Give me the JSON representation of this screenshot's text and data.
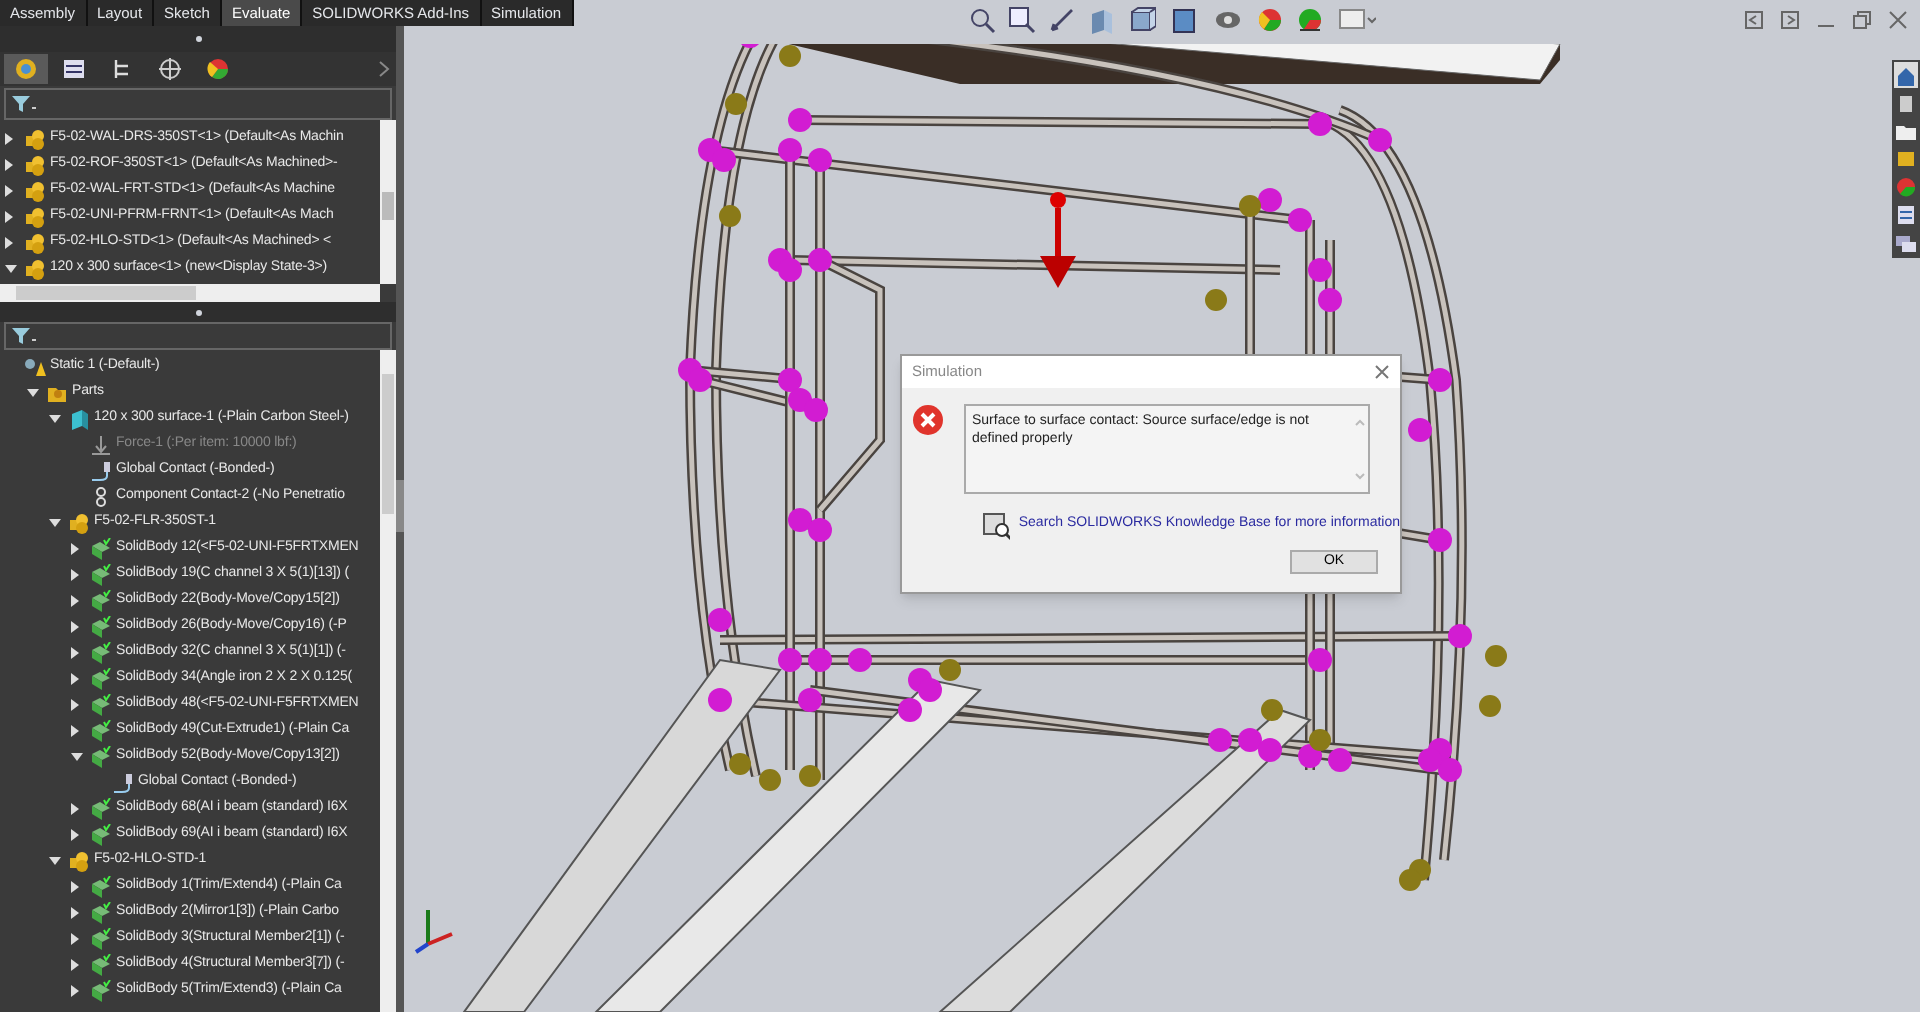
{
  "command_tabs": [
    {
      "label": "Assembly",
      "selected": false
    },
    {
      "label": "Layout",
      "selected": false
    },
    {
      "label": "Sketch",
      "selected": false
    },
    {
      "label": "Evaluate",
      "selected": true
    },
    {
      "label": "SOLIDWORKS Add-Ins",
      "selected": false
    },
    {
      "label": "Simulation",
      "selected": false
    }
  ],
  "feature_tree": {
    "items": [
      {
        "kind": "assembly",
        "label": "F5-02-WAL-DRS-350ST<1> (Default<As Machin",
        "expanded": false
      },
      {
        "kind": "assembly",
        "label": "F5-02-ROF-350ST<1> (Default<As Machined>-",
        "expanded": false
      },
      {
        "kind": "assembly",
        "label": "F5-02-WAL-FRT-STD<1> (Default<As Machine",
        "expanded": false
      },
      {
        "kind": "assembly",
        "label": "F5-02-UNI-PFRM-FRNT<1> (Default<As Mach",
        "expanded": false
      },
      {
        "kind": "assembly",
        "label": "F5-02-HLO-STD<1> (Default<As Machined> <",
        "expanded": false
      },
      {
        "kind": "assembly",
        "label": "120 x 300 surface<1> (new<Display State-3>)",
        "expanded": true
      }
    ]
  },
  "study_tree": {
    "items": [
      {
        "kind": "study",
        "label": "Static 1 (-Default-)",
        "children": [
          {
            "kind": "folder",
            "label": "Parts",
            "expanded": true,
            "children": [
              {
                "kind": "surface",
                "label": "120 x 300 surface-1 (-Plain Carbon Steel-)",
                "expanded": true,
                "children": [
                  {
                    "kind": "load",
                    "label": "Force-1 (:Per item: 10000 lbf:)",
                    "disabled": true
                  },
                  {
                    "kind": "contact",
                    "label": "Global Contact (-Bonded-)",
                    "disabled": false
                  },
                  {
                    "kind": "component-contact",
                    "label": "Component Contact-2 (-No Penetratio",
                    "disabled": false
                  }
                ]
              },
              {
                "kind": "assembly",
                "label": "F5-02-FLR-350ST-1",
                "expanded": true,
                "children": [
                  {
                    "kind": "body",
                    "label": "SolidBody 12(<F5-02-UNI-F5FRTXMEN",
                    "expanded": false
                  },
                  {
                    "kind": "body",
                    "label": "SolidBody 19(C channel 3 X 5(1)[13]) (",
                    "expanded": false
                  },
                  {
                    "kind": "body",
                    "label": "SolidBody 22(Body-Move/Copy15[2])",
                    "expanded": false
                  },
                  {
                    "kind": "body",
                    "label": "SolidBody 26(Body-Move/Copy16) (-P",
                    "expanded": false
                  },
                  {
                    "kind": "body",
                    "label": "SolidBody 32(C channel 3 X 5(1)[1]) (-",
                    "expanded": false
                  },
                  {
                    "kind": "body",
                    "label": "SolidBody 34(Angle iron 2 X 2 X 0.125(",
                    "expanded": false
                  },
                  {
                    "kind": "body",
                    "label": "SolidBody 48(<F5-02-UNI-F5FRTXMEN",
                    "expanded": false
                  },
                  {
                    "kind": "body",
                    "label": "SolidBody 49(Cut-Extrude1) (-Plain Ca",
                    "expanded": false
                  },
                  {
                    "kind": "body",
                    "label": "SolidBody 52(Body-Move/Copy13[2])",
                    "expanded": true,
                    "children": [
                      {
                        "kind": "contact",
                        "label": "Global Contact (-Bonded-)"
                      }
                    ]
                  },
                  {
                    "kind": "body",
                    "label": "SolidBody 68(AI i beam (standard) I6X",
                    "expanded": false
                  },
                  {
                    "kind": "body",
                    "label": "SolidBody 69(AI i beam (standard) I6X",
                    "expanded": false
                  }
                ]
              },
              {
                "kind": "assembly",
                "label": "F5-02-HLO-STD-1",
                "expanded": true,
                "children": [
                  {
                    "kind": "body",
                    "label": "SolidBody 1(Trim/Extend4) (-Plain Ca",
                    "expanded": false
                  },
                  {
                    "kind": "body",
                    "label": "SolidBody 2(Mirror1[3]) (-Plain Carbo",
                    "expanded": false
                  },
                  {
                    "kind": "body",
                    "label": "SolidBody 3(Structural Member2[1]) (-",
                    "expanded": false
                  },
                  {
                    "kind": "body",
                    "label": "SolidBody 4(Structural Member3[7]) (-",
                    "expanded": false
                  },
                  {
                    "kind": "body",
                    "label": "SolidBody 5(Trim/Extend3) (-Plain Ca",
                    "expanded": false
                  }
                ]
              }
            ]
          }
        ]
      }
    ]
  },
  "dialog": {
    "title": "Simulation",
    "message": "Surface to surface contact: Source surface/edge is not defined properly",
    "link": "Search SOLIDWORKS Knowledge Base for more information",
    "button": "OK"
  }
}
